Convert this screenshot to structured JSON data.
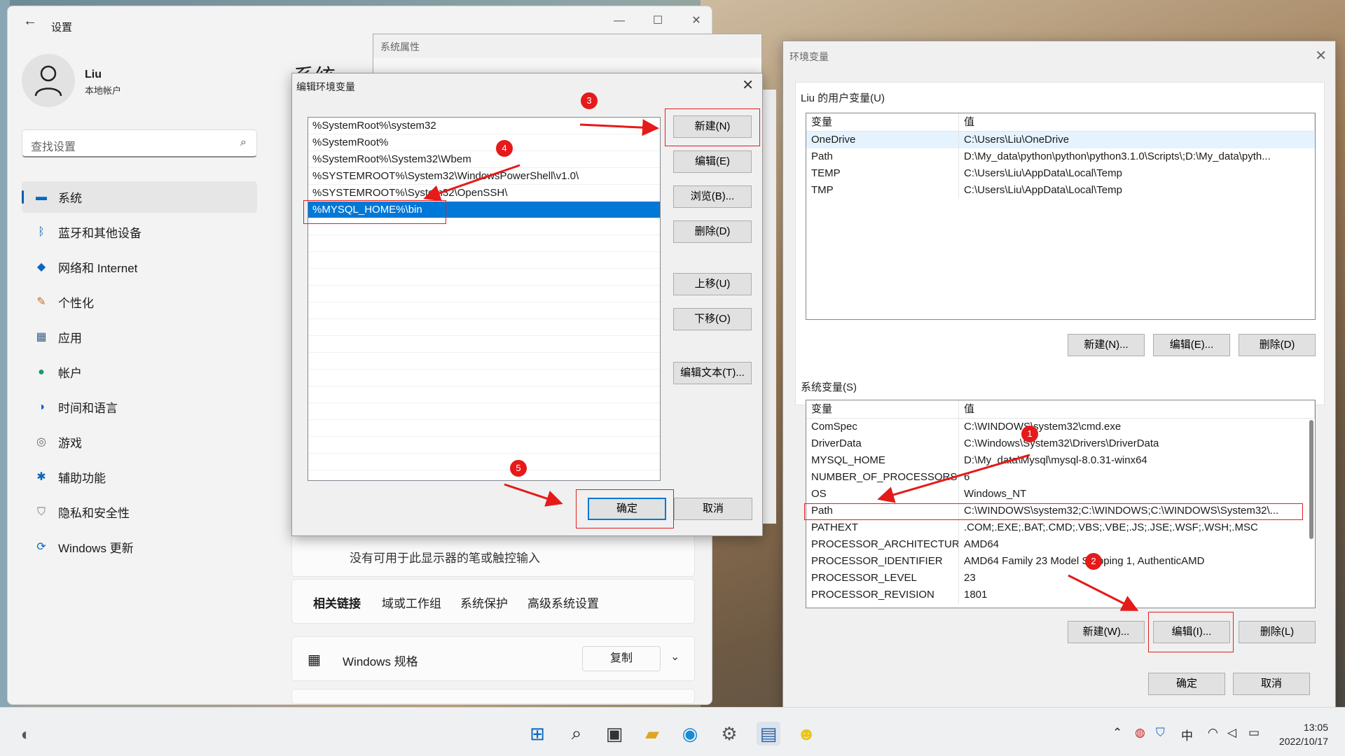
{
  "settings": {
    "title": "设置",
    "user_name": "Liu",
    "user_sub": "本地帐户",
    "search_placeholder": "查找设置",
    "content_title": "系统",
    "nav": [
      {
        "label": "系统",
        "icon": "monitor-icon"
      },
      {
        "label": "蓝牙和其他设备",
        "icon": "bluetooth-icon"
      },
      {
        "label": "网络和 Internet",
        "icon": "wifi-icon"
      },
      {
        "label": "个性化",
        "icon": "brush-icon"
      },
      {
        "label": "应用",
        "icon": "apps-icon"
      },
      {
        "label": "帐户",
        "icon": "person-icon"
      },
      {
        "label": "时间和语言",
        "icon": "globe-icon"
      },
      {
        "label": "游戏",
        "icon": "gamepad-icon"
      },
      {
        "label": "辅助功能",
        "icon": "accessibility-icon"
      },
      {
        "label": "隐私和安全性",
        "icon": "shield-icon"
      },
      {
        "label": "Windows 更新",
        "icon": "update-icon"
      }
    ],
    "pen_touch_text": "没有可用于此显示器的笔或触控输入",
    "related_links_label": "相关链接",
    "related_links": [
      "域或工作组",
      "系统保护",
      "高级系统设置"
    ],
    "win_spec_label": "Windows 规格",
    "copy_label": "复制"
  },
  "sysprops": {
    "title": "系统属性"
  },
  "edit_dialog": {
    "title": "编辑环境变量",
    "paths": [
      "%SystemRoot%\\system32",
      "%SystemRoot%",
      "%SystemRoot%\\System32\\Wbem",
      "%SYSTEMROOT%\\System32\\WindowsPowerShell\\v1.0\\",
      "%SYSTEMROOT%\\System32\\OpenSSH\\",
      "%MYSQL_HOME%\\bin"
    ],
    "btn_new": "新建(N)",
    "btn_edit": "编辑(E)",
    "btn_browse": "浏览(B)...",
    "btn_delete": "删除(D)",
    "btn_up": "上移(U)",
    "btn_down": "下移(O)",
    "btn_edit_text": "编辑文本(T)...",
    "btn_ok": "确定",
    "btn_cancel": "取消"
  },
  "env_dialog": {
    "title": "环境变量",
    "user_group": "Liu 的用户变量(U)",
    "col_var": "变量",
    "col_val": "值",
    "user_vars": [
      {
        "name": "OneDrive",
        "value": "C:\\Users\\Liu\\OneDrive"
      },
      {
        "name": "Path",
        "value": "D:\\My_data\\python\\python\\python3.1.0\\Scripts\\;D:\\My_data\\pyth..."
      },
      {
        "name": "TEMP",
        "value": "C:\\Users\\Liu\\AppData\\Local\\Temp"
      },
      {
        "name": "TMP",
        "value": "C:\\Users\\Liu\\AppData\\Local\\Temp"
      }
    ],
    "user_btn_new": "新建(N)...",
    "user_btn_edit": "编辑(E)...",
    "user_btn_delete": "删除(D)",
    "sys_group": "系统变量(S)",
    "sys_vars": [
      {
        "name": "ComSpec",
        "value": "C:\\WINDOWS\\system32\\cmd.exe"
      },
      {
        "name": "DriverData",
        "value": "C:\\Windows\\System32\\Drivers\\DriverData"
      },
      {
        "name": "MYSQL_HOME",
        "value": "D:\\My_data\\Mysql\\mysql-8.0.31-winx64"
      },
      {
        "name": "NUMBER_OF_PROCESSORS",
        "value": "6"
      },
      {
        "name": "OS",
        "value": "Windows_NT"
      },
      {
        "name": "Path",
        "value": "C:\\WINDOWS\\system32;C:\\WINDOWS;C:\\WINDOWS\\System32\\..."
      },
      {
        "name": "PATHEXT",
        "value": ".COM;.EXE;.BAT;.CMD;.VBS;.VBE;.JS;.JSE;.WSF;.WSH;.MSC"
      },
      {
        "name": "PROCESSOR_ARCHITECTURE",
        "value": "AMD64"
      },
      {
        "name": "PROCESSOR_IDENTIFIER",
        "value": "AMD64 Family 23 Model  Stepping 1, AuthenticAMD"
      },
      {
        "name": "PROCESSOR_LEVEL",
        "value": "23"
      },
      {
        "name": "PROCESSOR_REVISION",
        "value": "1801"
      }
    ],
    "sys_btn_new": "新建(W)...",
    "sys_btn_edit": "编辑(I)...",
    "sys_btn_delete": "删除(L)",
    "btn_ok": "确定",
    "btn_cancel": "取消"
  },
  "annotations": [
    "1",
    "2",
    "3",
    "4",
    "5"
  ],
  "taskbar": {
    "ime": "中",
    "time": "13:05",
    "date": "2022/10/17"
  },
  "colors": {
    "accent": "#0078d7",
    "annotation": "#e51a1a"
  }
}
